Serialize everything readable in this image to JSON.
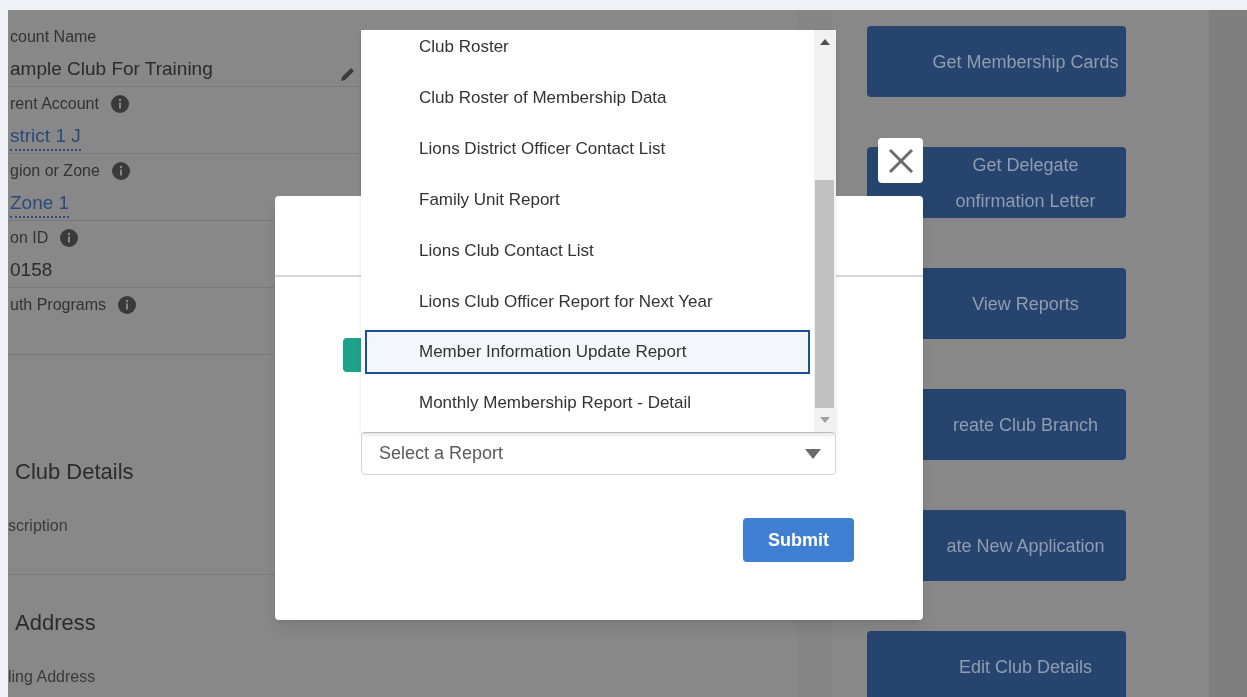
{
  "account_fields": [
    {
      "label": "count Name",
      "value": "ample Club For Training",
      "kind": "text",
      "info": false,
      "editable": true
    },
    {
      "label": "rent Account",
      "value": "strict 1 J",
      "kind": "link",
      "info": true,
      "editable": false
    },
    {
      "label": "gion or Zone",
      "value": "Zone 1",
      "kind": "link",
      "info": true,
      "editable": false
    },
    {
      "label": "on ID",
      "value": "0158",
      "kind": "text",
      "info": true,
      "editable": false
    },
    {
      "label": "uth Programs",
      "info": true,
      "editable": false
    }
  ],
  "sections": [
    {
      "heading": "Club Details",
      "field_label": "scription"
    },
    {
      "heading": "Address",
      "field_label": "ling Address"
    }
  ],
  "actions": [
    {
      "lines": [
        "Get Membership Cards"
      ]
    },
    {
      "lines": [
        "Get Delegate",
        "onfirmation Letter"
      ]
    },
    {
      "lines": [
        "View Reports"
      ]
    },
    {
      "lines": [
        "reate Club Branch"
      ]
    },
    {
      "lines": [
        "ate New Application"
      ]
    },
    {
      "lines": [
        "Edit Club Details"
      ]
    }
  ],
  "report_options": [
    {
      "label": "Club Roster",
      "selected": false
    },
    {
      "label": "Club Roster of Membership Data",
      "selected": false
    },
    {
      "label": "Lions District Officer Contact List",
      "selected": false
    },
    {
      "label": "Family Unit Report",
      "selected": false
    },
    {
      "label": "Lions Club Contact List",
      "selected": false
    },
    {
      "label": "Lions Club Officer Report for Next Year",
      "selected": false
    },
    {
      "label": "Member Information Update Report",
      "selected": true
    },
    {
      "label": "Monthly Membership Report - Detail",
      "selected": false
    }
  ],
  "report_select": {
    "placeholder": "Select a Report"
  },
  "submit_button": "Submit"
}
